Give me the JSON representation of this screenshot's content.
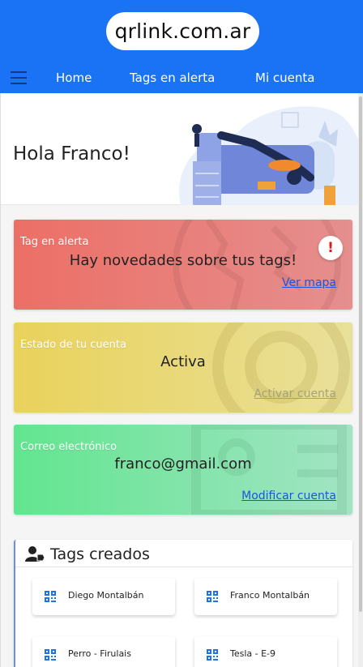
{
  "header": {
    "logo_text": "qrlink.com.ar",
    "nav": {
      "home": "Home",
      "alerts": "Tags en alerta",
      "account": "Mi cuenta"
    }
  },
  "greeting": "Hola Franco!",
  "cards": {
    "alert": {
      "label": "Tag en alerta",
      "message": "Hay novedades sobre tus tags!",
      "link": "Ver mapa",
      "badge": "!"
    },
    "status": {
      "label": "Estado de tu cuenta",
      "value": "Activa",
      "link": "Activar cuenta"
    },
    "email": {
      "label": "Correo electrónico",
      "value": "franco@gmail.com",
      "link": "Modificar cuenta"
    }
  },
  "tags_section": {
    "title": "Tags creados",
    "tags": [
      "Diego Montalbán",
      "Franco Montalbán",
      "Perro - Firulais",
      "Tesla - E-9"
    ]
  },
  "colors": {
    "primary": "#1a73f5",
    "alert": "#ec6f66",
    "status": "#e9d25b",
    "email": "#62e58f",
    "link": "#1a56db"
  }
}
